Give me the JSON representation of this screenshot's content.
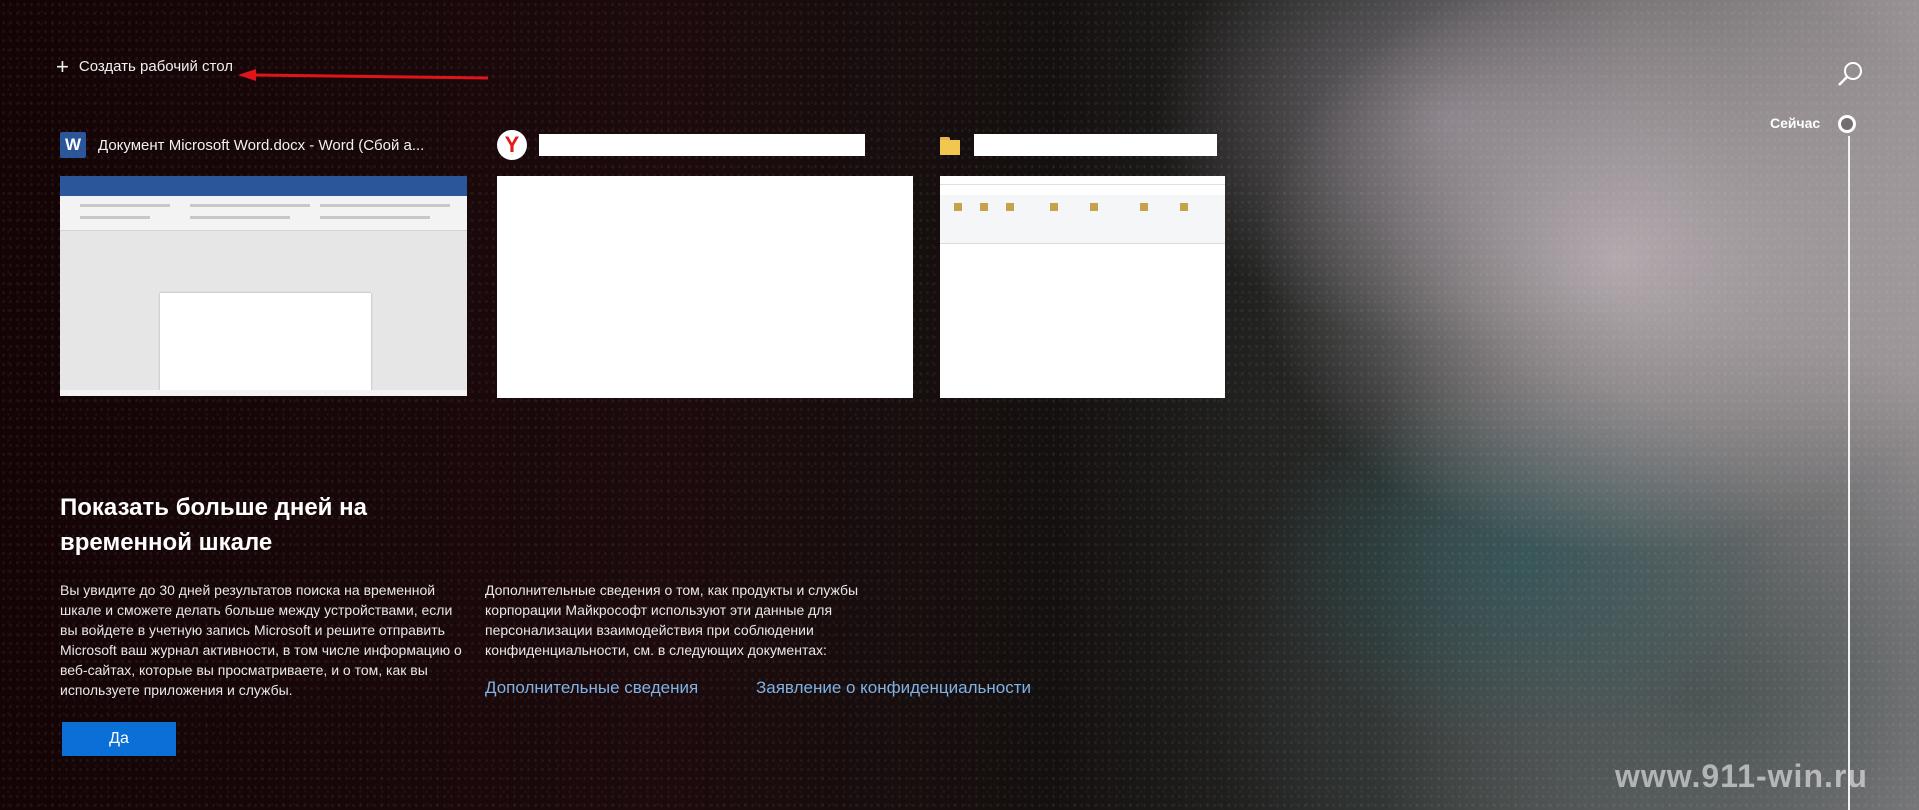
{
  "header": {
    "new_desktop_label": "Создать рабочий стол"
  },
  "timeline": {
    "now_label": "Сейчас"
  },
  "cards": [
    {
      "app": "word",
      "icon": "word-icon",
      "icon_text": "W",
      "title": "Документ Microsoft Word.docx - Word (Сбой а..."
    },
    {
      "app": "yandex",
      "icon": "yandex-browser-icon",
      "icon_text": "Y",
      "title": ""
    },
    {
      "app": "explorer",
      "icon": "folder-icon",
      "title": ""
    }
  ],
  "prompt": {
    "title": "Показать больше дней на временной шкале",
    "body": "Вы увидите до 30 дней результатов поиска на временной шкале и сможете делать больше между устройствами, если вы войдете в учетную запись Microsoft и решите отправить Microsoft ваш журнал активности, в том числе информацию о веб-сайтах, которые вы просматриваете, и о том, как вы используете приложения и службы.",
    "privacy_text": "Дополнительные сведения о том, как продукты и службы корпорации Майкрософт используют эти данные для персонализации взаимодействия при соблюдении конфиденциальности, см. в следующих документах:",
    "more_info_link": "Дополнительные сведения",
    "privacy_link": "Заявление о конфиденциальности",
    "yes_button": "Да"
  },
  "watermark": "www.911-win.ru",
  "colors": {
    "accent_button": "#0a6fd6",
    "link": "#7fb2e5",
    "annotation_arrow": "#e0141b",
    "word_brand": "#2b579a",
    "yandex_brand": "#e21b1b"
  }
}
